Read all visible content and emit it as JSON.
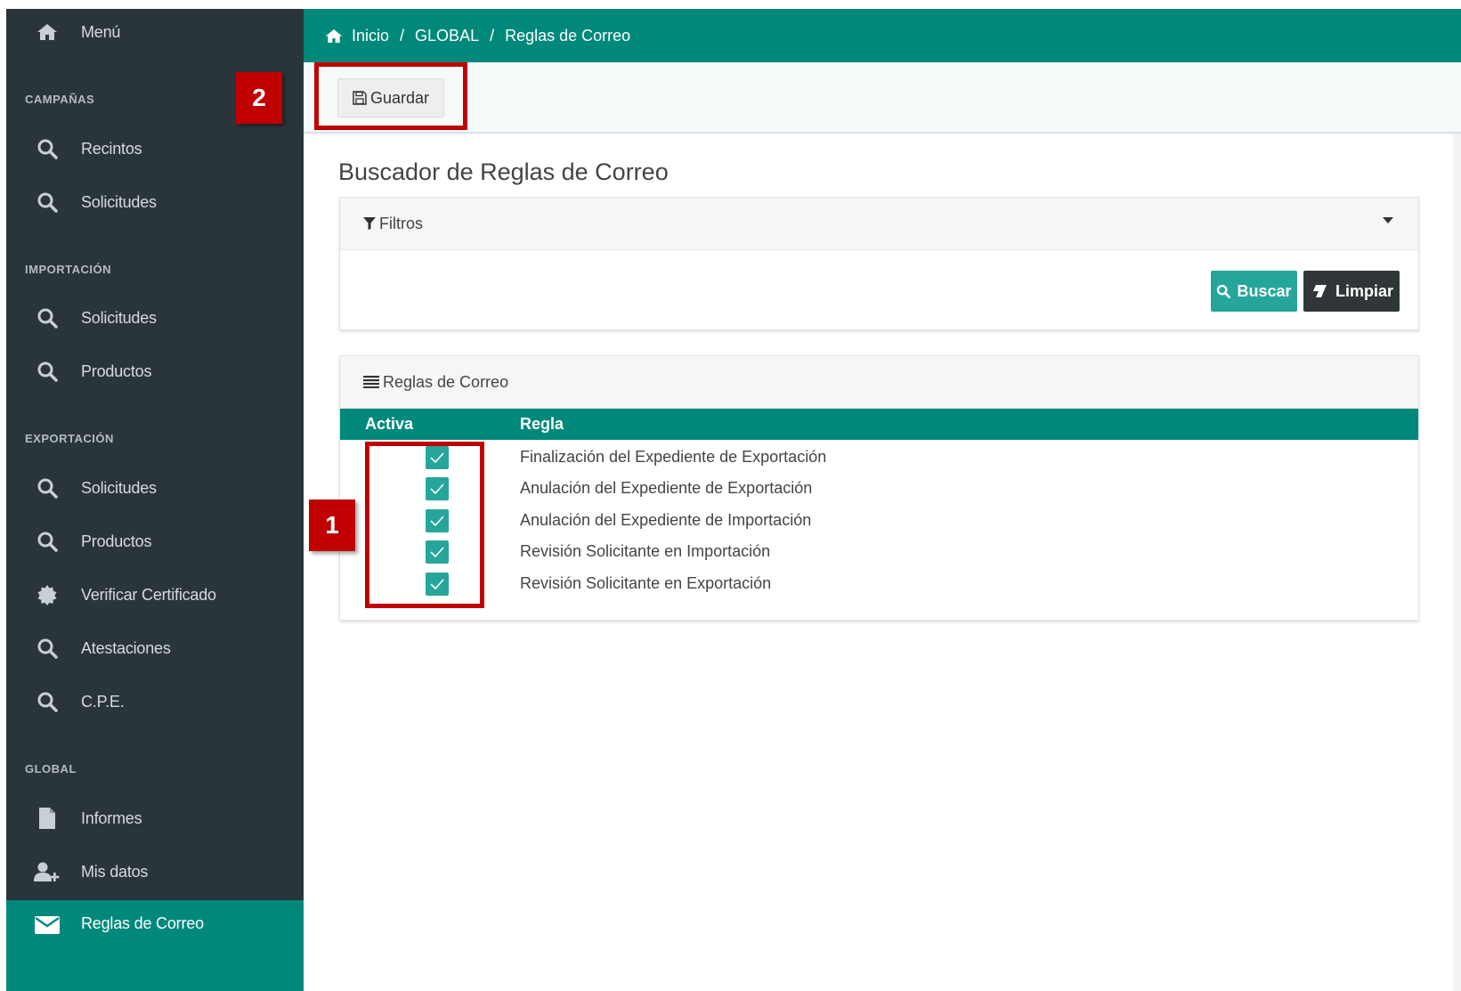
{
  "sidebar": {
    "menu_label": "Menú",
    "sections": {
      "campanas": "CAMPAÑAS",
      "importacion": "IMPORTACIÓN",
      "exportacion": "EXPORTACIÓN",
      "global": "GLOBAL"
    },
    "items": [
      {
        "label": "Recintos",
        "icon": "search-icon"
      },
      {
        "label": "Solicitudes",
        "icon": "search-icon"
      },
      {
        "label": "Solicitudes",
        "icon": "search-icon"
      },
      {
        "label": "Productos",
        "icon": "search-icon"
      },
      {
        "label": "Solicitudes",
        "icon": "search-icon"
      },
      {
        "label": "Productos",
        "icon": "search-icon"
      },
      {
        "label": "Verificar Certificado",
        "icon": "certificate-icon"
      },
      {
        "label": "Atestaciones",
        "icon": "search-icon"
      },
      {
        "label": "C.P.E.",
        "icon": "search-icon"
      },
      {
        "label": "Informes",
        "icon": "file-icon"
      },
      {
        "label": "Mis datos",
        "icon": "user-plus-icon"
      },
      {
        "label": "Reglas de Correo",
        "icon": "envelope-icon",
        "active": true
      }
    ]
  },
  "breadcrumb": {
    "home": "Inicio",
    "section": "GLOBAL",
    "current": "Reglas de Correo"
  },
  "toolbar": {
    "save_label": "Guardar"
  },
  "annotations": {
    "box1_number": "1",
    "box2_number": "2",
    "color": "#c00000"
  },
  "main": {
    "title": "Buscador de Reglas de Correo",
    "filters": {
      "header": "Filtros",
      "search_label": "Buscar",
      "clear_label": "Limpiar"
    },
    "rules": {
      "header": "Reglas de Correo",
      "columns": [
        "Activa",
        "Regla"
      ],
      "rows": [
        {
          "active": true,
          "rule": "Finalización del Expediente de Exportación"
        },
        {
          "active": true,
          "rule": "Anulación del Expediente de Exportación"
        },
        {
          "active": true,
          "rule": "Anulación del Expediente de Importación"
        },
        {
          "active": true,
          "rule": "Revisión Solicitante en Importación"
        },
        {
          "active": true,
          "rule": "Revisión Solicitante en Exportación"
        }
      ]
    }
  },
  "colors": {
    "sidebar_bg": "#2a353b",
    "accent": "#00897b",
    "checkbox": "#26a69a",
    "clear_button": "#303638"
  }
}
